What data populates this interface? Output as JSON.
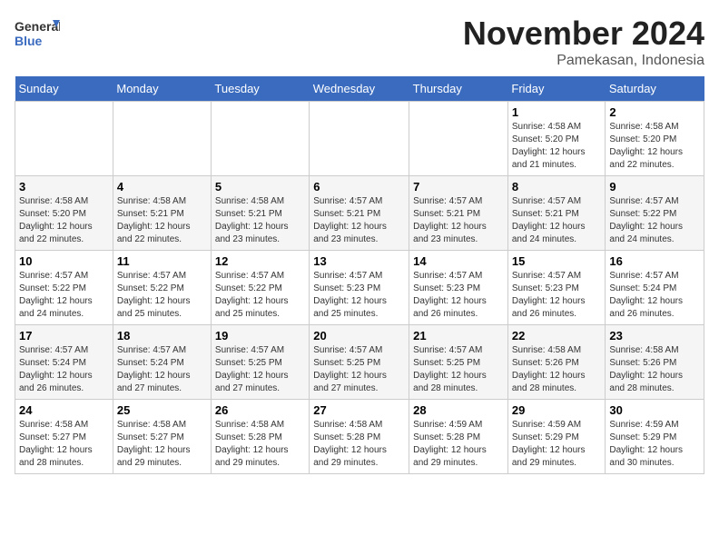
{
  "logo": {
    "line1": "General",
    "line2": "Blue"
  },
  "title": "November 2024",
  "location": "Pamekasan, Indonesia",
  "days_of_week": [
    "Sunday",
    "Monday",
    "Tuesday",
    "Wednesday",
    "Thursday",
    "Friday",
    "Saturday"
  ],
  "weeks": [
    [
      {
        "day": "",
        "info": ""
      },
      {
        "day": "",
        "info": ""
      },
      {
        "day": "",
        "info": ""
      },
      {
        "day": "",
        "info": ""
      },
      {
        "day": "",
        "info": ""
      },
      {
        "day": "1",
        "info": "Sunrise: 4:58 AM\nSunset: 5:20 PM\nDaylight: 12 hours\nand 21 minutes."
      },
      {
        "day": "2",
        "info": "Sunrise: 4:58 AM\nSunset: 5:20 PM\nDaylight: 12 hours\nand 22 minutes."
      }
    ],
    [
      {
        "day": "3",
        "info": "Sunrise: 4:58 AM\nSunset: 5:20 PM\nDaylight: 12 hours\nand 22 minutes."
      },
      {
        "day": "4",
        "info": "Sunrise: 4:58 AM\nSunset: 5:21 PM\nDaylight: 12 hours\nand 22 minutes."
      },
      {
        "day": "5",
        "info": "Sunrise: 4:58 AM\nSunset: 5:21 PM\nDaylight: 12 hours\nand 23 minutes."
      },
      {
        "day": "6",
        "info": "Sunrise: 4:57 AM\nSunset: 5:21 PM\nDaylight: 12 hours\nand 23 minutes."
      },
      {
        "day": "7",
        "info": "Sunrise: 4:57 AM\nSunset: 5:21 PM\nDaylight: 12 hours\nand 23 minutes."
      },
      {
        "day": "8",
        "info": "Sunrise: 4:57 AM\nSunset: 5:21 PM\nDaylight: 12 hours\nand 24 minutes."
      },
      {
        "day": "9",
        "info": "Sunrise: 4:57 AM\nSunset: 5:22 PM\nDaylight: 12 hours\nand 24 minutes."
      }
    ],
    [
      {
        "day": "10",
        "info": "Sunrise: 4:57 AM\nSunset: 5:22 PM\nDaylight: 12 hours\nand 24 minutes."
      },
      {
        "day": "11",
        "info": "Sunrise: 4:57 AM\nSunset: 5:22 PM\nDaylight: 12 hours\nand 25 minutes."
      },
      {
        "day": "12",
        "info": "Sunrise: 4:57 AM\nSunset: 5:22 PM\nDaylight: 12 hours\nand 25 minutes."
      },
      {
        "day": "13",
        "info": "Sunrise: 4:57 AM\nSunset: 5:23 PM\nDaylight: 12 hours\nand 25 minutes."
      },
      {
        "day": "14",
        "info": "Sunrise: 4:57 AM\nSunset: 5:23 PM\nDaylight: 12 hours\nand 26 minutes."
      },
      {
        "day": "15",
        "info": "Sunrise: 4:57 AM\nSunset: 5:23 PM\nDaylight: 12 hours\nand 26 minutes."
      },
      {
        "day": "16",
        "info": "Sunrise: 4:57 AM\nSunset: 5:24 PM\nDaylight: 12 hours\nand 26 minutes."
      }
    ],
    [
      {
        "day": "17",
        "info": "Sunrise: 4:57 AM\nSunset: 5:24 PM\nDaylight: 12 hours\nand 26 minutes."
      },
      {
        "day": "18",
        "info": "Sunrise: 4:57 AM\nSunset: 5:24 PM\nDaylight: 12 hours\nand 27 minutes."
      },
      {
        "day": "19",
        "info": "Sunrise: 4:57 AM\nSunset: 5:25 PM\nDaylight: 12 hours\nand 27 minutes."
      },
      {
        "day": "20",
        "info": "Sunrise: 4:57 AM\nSunset: 5:25 PM\nDaylight: 12 hours\nand 27 minutes."
      },
      {
        "day": "21",
        "info": "Sunrise: 4:57 AM\nSunset: 5:25 PM\nDaylight: 12 hours\nand 28 minutes."
      },
      {
        "day": "22",
        "info": "Sunrise: 4:58 AM\nSunset: 5:26 PM\nDaylight: 12 hours\nand 28 minutes."
      },
      {
        "day": "23",
        "info": "Sunrise: 4:58 AM\nSunset: 5:26 PM\nDaylight: 12 hours\nand 28 minutes."
      }
    ],
    [
      {
        "day": "24",
        "info": "Sunrise: 4:58 AM\nSunset: 5:27 PM\nDaylight: 12 hours\nand 28 minutes."
      },
      {
        "day": "25",
        "info": "Sunrise: 4:58 AM\nSunset: 5:27 PM\nDaylight: 12 hours\nand 29 minutes."
      },
      {
        "day": "26",
        "info": "Sunrise: 4:58 AM\nSunset: 5:28 PM\nDaylight: 12 hours\nand 29 minutes."
      },
      {
        "day": "27",
        "info": "Sunrise: 4:58 AM\nSunset: 5:28 PM\nDaylight: 12 hours\nand 29 minutes."
      },
      {
        "day": "28",
        "info": "Sunrise: 4:59 AM\nSunset: 5:28 PM\nDaylight: 12 hours\nand 29 minutes."
      },
      {
        "day": "29",
        "info": "Sunrise: 4:59 AM\nSunset: 5:29 PM\nDaylight: 12 hours\nand 29 minutes."
      },
      {
        "day": "30",
        "info": "Sunrise: 4:59 AM\nSunset: 5:29 PM\nDaylight: 12 hours\nand 30 minutes."
      }
    ]
  ]
}
